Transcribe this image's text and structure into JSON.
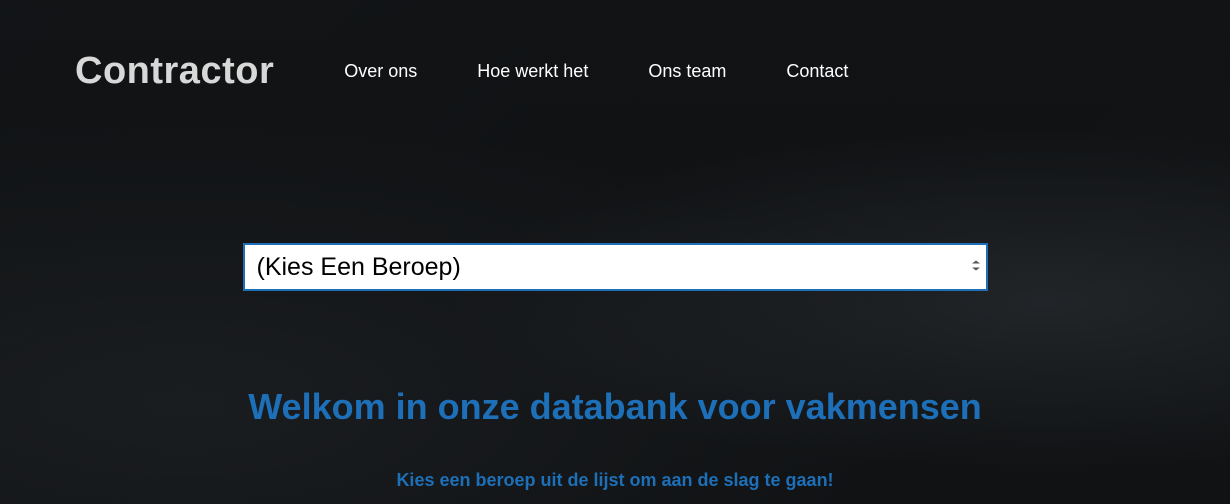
{
  "brand": {
    "name": "Contractor"
  },
  "nav": {
    "items": [
      {
        "label": "Over ons"
      },
      {
        "label": "Hoe werkt het"
      },
      {
        "label": "Ons team"
      },
      {
        "label": "Contact"
      }
    ]
  },
  "select": {
    "placeholder": "(Kies Een Beroep)"
  },
  "hero": {
    "title": "Welkom in onze databank voor vakmensen",
    "subtitle": "Kies een beroep uit de lijst om aan de slag te gaan!"
  },
  "colors": {
    "accent": "#1d6fb8"
  }
}
